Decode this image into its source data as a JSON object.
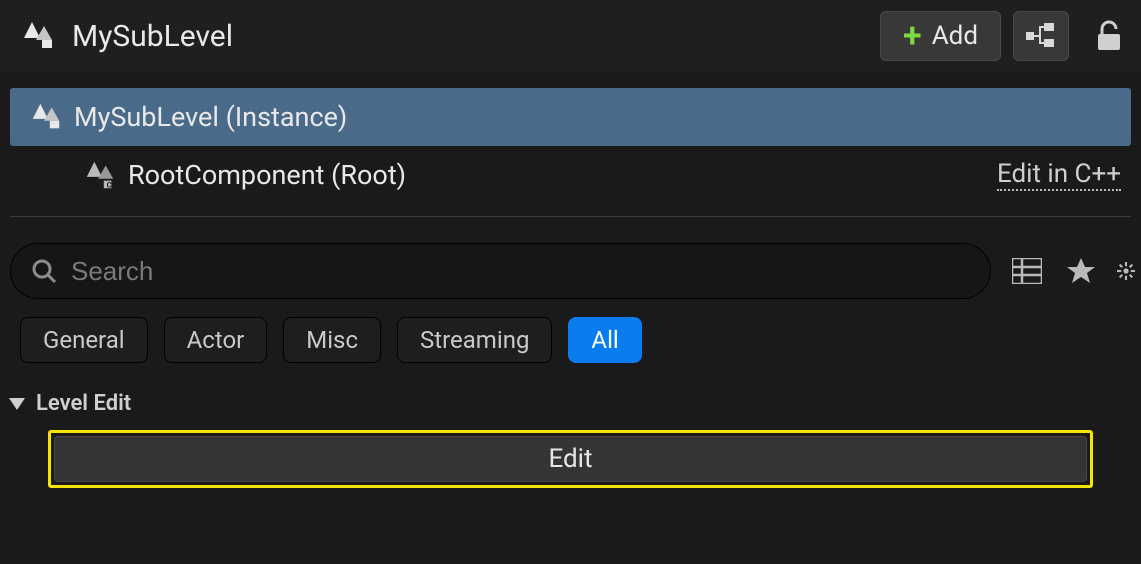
{
  "header": {
    "title": "MySubLevel",
    "add_label": "Add"
  },
  "outliner": {
    "selected": {
      "label": "MySubLevel (Instance)"
    },
    "child": {
      "label": "RootComponent (Root)",
      "edit_link": "Edit in C++"
    }
  },
  "search": {
    "placeholder": "Search"
  },
  "filters": {
    "items": [
      {
        "label": "General",
        "active": false
      },
      {
        "label": "Actor",
        "active": false
      },
      {
        "label": "Misc",
        "active": false
      },
      {
        "label": "Streaming",
        "active": false
      },
      {
        "label": "All",
        "active": true
      }
    ]
  },
  "section": {
    "title": "Level Edit",
    "edit_button": "Edit"
  }
}
